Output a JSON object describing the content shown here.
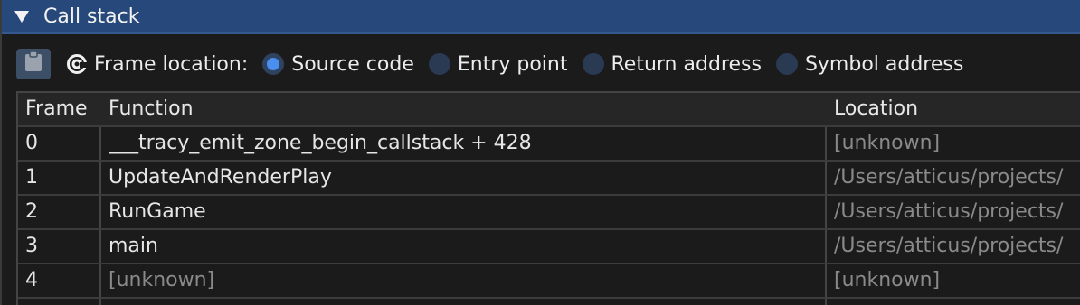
{
  "window": {
    "title": "Call stack"
  },
  "toolbar": {
    "frame_location_label": "Frame location:",
    "options": [
      {
        "label": "Source code",
        "selected": true
      },
      {
        "label": "Entry point",
        "selected": false
      },
      {
        "label": "Return address",
        "selected": false
      },
      {
        "label": "Symbol address",
        "selected": false
      }
    ]
  },
  "table": {
    "columns": [
      "Frame",
      "Function",
      "Location"
    ],
    "rows": [
      {
        "frame": "0",
        "function": "___tracy_emit_zone_begin_callstack + 428",
        "location": "[unknown]"
      },
      {
        "frame": "1",
        "function": "UpdateAndRenderPlay",
        "location": "/Users/atticus/projects/"
      },
      {
        "frame": "2",
        "function": "RunGame",
        "location": "/Users/atticus/projects/"
      },
      {
        "frame": "3",
        "function": "main",
        "location": "/Users/atticus/projects/"
      },
      {
        "frame": "4",
        "function": "[unknown]",
        "location": "[unknown]"
      }
    ]
  },
  "colors": {
    "titlebar": "#26487a",
    "radio_selected": "#4a8ff0",
    "dim_text": "#8a8a8a"
  }
}
